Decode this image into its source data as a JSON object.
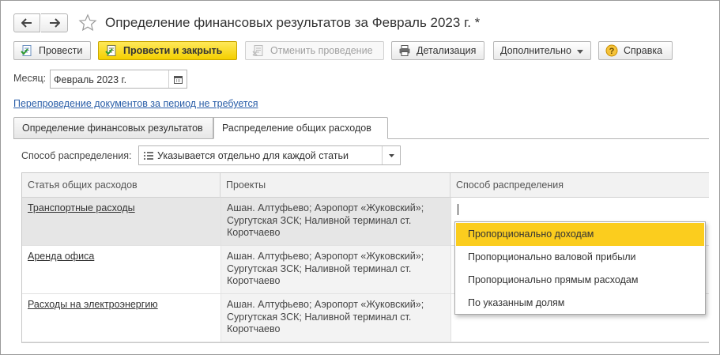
{
  "window": {
    "title": "Определение финансовых результатов за Февраль 2023 г. *"
  },
  "toolbar": {
    "post_label": "Провести",
    "post_close_label": "Провести и закрыть",
    "cancel_post_label": "Отменить проведение",
    "detail_label": "Детализация",
    "more_label": "Дополнительно",
    "help_label": "Справка"
  },
  "month": {
    "label": "Месяц:",
    "value": "Февраль 2023 г."
  },
  "repost_link": "Перепроведение документов за период не требуется",
  "tabs": [
    {
      "label": "Определение финансовых результатов",
      "active": false
    },
    {
      "label": "Распределение общих расходов",
      "active": true
    }
  ],
  "distribution": {
    "label": "Способ распределения:",
    "value": "Указывается отдельно для каждой статьи"
  },
  "table": {
    "columns": [
      "Статья общих расходов",
      "Проекты",
      "Способ распределения"
    ],
    "rows": [
      {
        "article": "Транспортные расходы",
        "projects_line1": "Ашан. Алтуфьево;  Аэропорт «Жуковский»;",
        "projects_line2": "Сургутская ЗСК;  Наливной терминал ст.",
        "projects_line3": "Коротчаево",
        "method": ""
      },
      {
        "article": "Аренда офиса",
        "projects_line1": "Ашан. Алтуфьево;  Аэропорт «Жуковский»;",
        "projects_line2": "Сургутская ЗСК;  Наливной терминал ст.",
        "projects_line3": "Коротчаево",
        "method": ""
      },
      {
        "article": "Расходы на электроэнергию",
        "projects_line1": "Ашан. Алтуфьево;  Аэропорт «Жуковский»;",
        "projects_line2": "Сургутская ЗСК;  Наливной терминал ст.",
        "projects_line3": "Коротчаево",
        "method": ""
      }
    ]
  },
  "dropdown": {
    "options": [
      "Пропорционально доходам",
      "Пропорционально валовой прибыли",
      "Пропорционально прямым расходам",
      "По указанным долям"
    ],
    "highlighted_index": 0
  },
  "colors": {
    "primary_button": "#f4cf00",
    "highlight": "#fbcd1e",
    "link": "#2a5ea8"
  }
}
